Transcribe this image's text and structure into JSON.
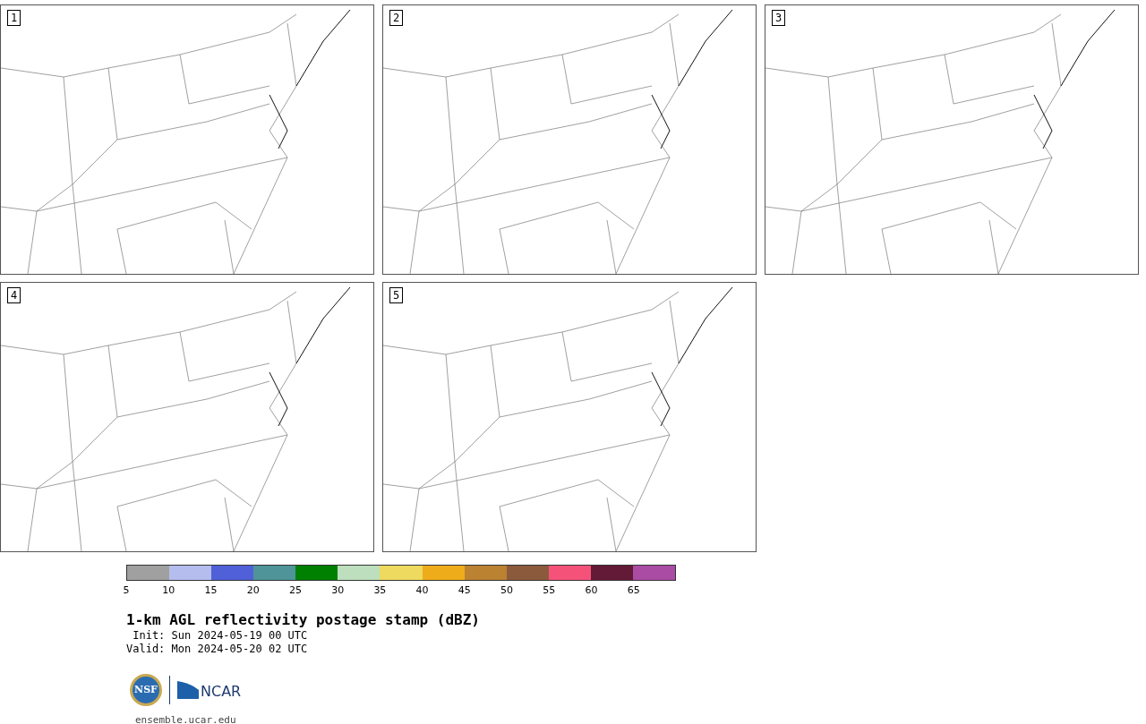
{
  "panels": [
    {
      "label": "1"
    },
    {
      "label": "2"
    },
    {
      "label": "3"
    },
    {
      "label": "4"
    },
    {
      "label": "5"
    }
  ],
  "colorbar": {
    "swatches": [
      {
        "color": "#a0a0a0"
      },
      {
        "color": "#b4bded"
      },
      {
        "color": "#5060d8"
      },
      {
        "color": "#4f9499"
      },
      {
        "color": "#008000"
      },
      {
        "color": "#bddfbd"
      },
      {
        "color": "#eeda5e"
      },
      {
        "color": "#efac1a"
      },
      {
        "color": "#ba8231"
      },
      {
        "color": "#8b5a3d"
      },
      {
        "color": "#f5527a"
      },
      {
        "color": "#621a36"
      },
      {
        "color": "#aa4ca4"
      }
    ],
    "ticks": [
      "5",
      "10",
      "15",
      "20",
      "25",
      "30",
      "35",
      "40",
      "45",
      "50",
      "55",
      "60",
      "65"
    ]
  },
  "title": "1-km AGL reflectivity postage stamp (dBZ)",
  "init": " Init: Sun 2024-05-19 00 UTC",
  "valid": "Valid: Mon 2024-05-20 02 UTC",
  "logo": {
    "left": "NSF",
    "right": "NCAR"
  },
  "footer": "ensemble.ucar.edu"
}
